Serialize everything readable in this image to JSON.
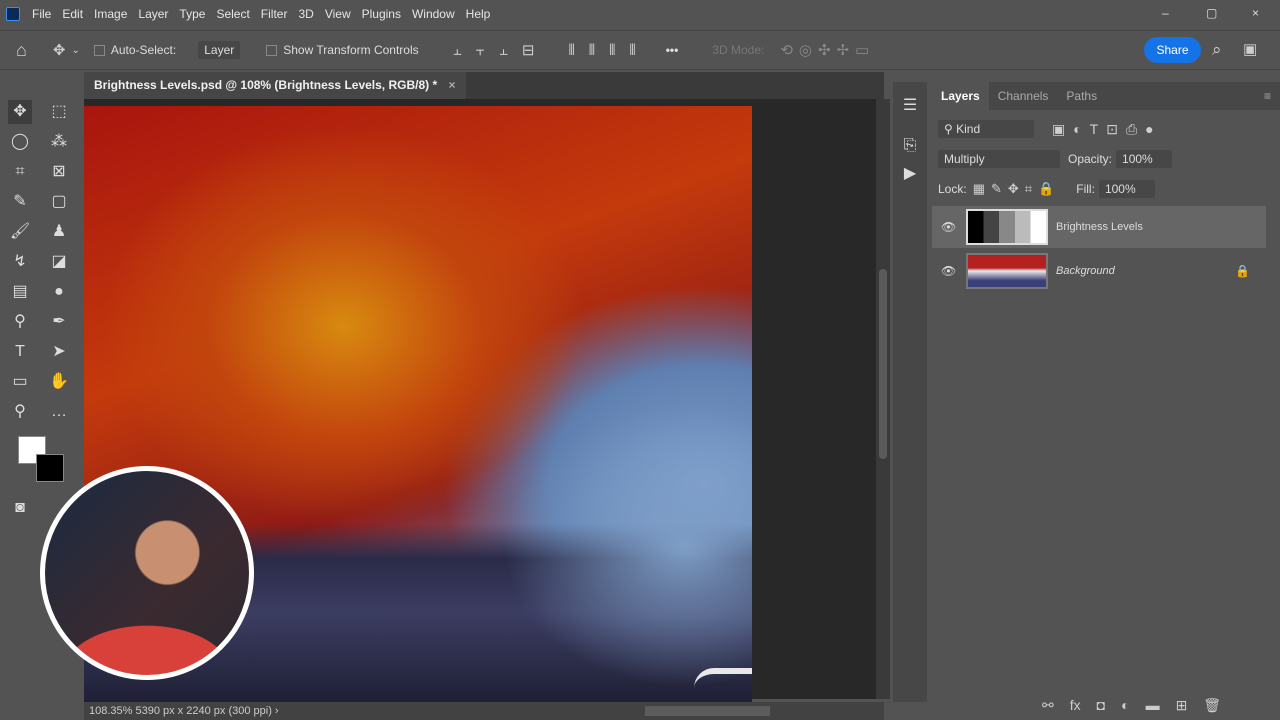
{
  "menu": [
    "File",
    "Edit",
    "Image",
    "Layer",
    "Type",
    "Select",
    "Filter",
    "3D",
    "View",
    "Plugins",
    "Window",
    "Help"
  ],
  "window_controls": {
    "minimize": "–",
    "restore": "▢",
    "close": "×"
  },
  "options": {
    "auto_select_label": "Auto-Select:",
    "auto_select_value": "Layer",
    "show_transform_label": "Show Transform Controls",
    "more": "•••",
    "mode_3d": "3D Mode:",
    "share": "Share"
  },
  "document_tab": {
    "title": "Brightness Levels.psd @ 108% (Brightness Levels, RGB/8) *",
    "close": "×"
  },
  "status": {
    "text": "108.35%   5390 px x 2240 px (300 ppi)   ›"
  },
  "layers_panel": {
    "tabs": [
      "Layers",
      "Channels",
      "Paths"
    ],
    "filter_kind": "Kind",
    "blend_mode": "Multiply",
    "opacity_label": "Opacity:",
    "opacity": "100%",
    "lock_label": "Lock:",
    "fill_label": "Fill:",
    "fill": "100%",
    "layers": [
      {
        "name": "Brightness Levels",
        "visible": true,
        "selected": true
      },
      {
        "name": "Background",
        "visible": true,
        "locked": true
      }
    ]
  },
  "colors": {
    "accent": "#1473e6",
    "bg": "#535353"
  }
}
